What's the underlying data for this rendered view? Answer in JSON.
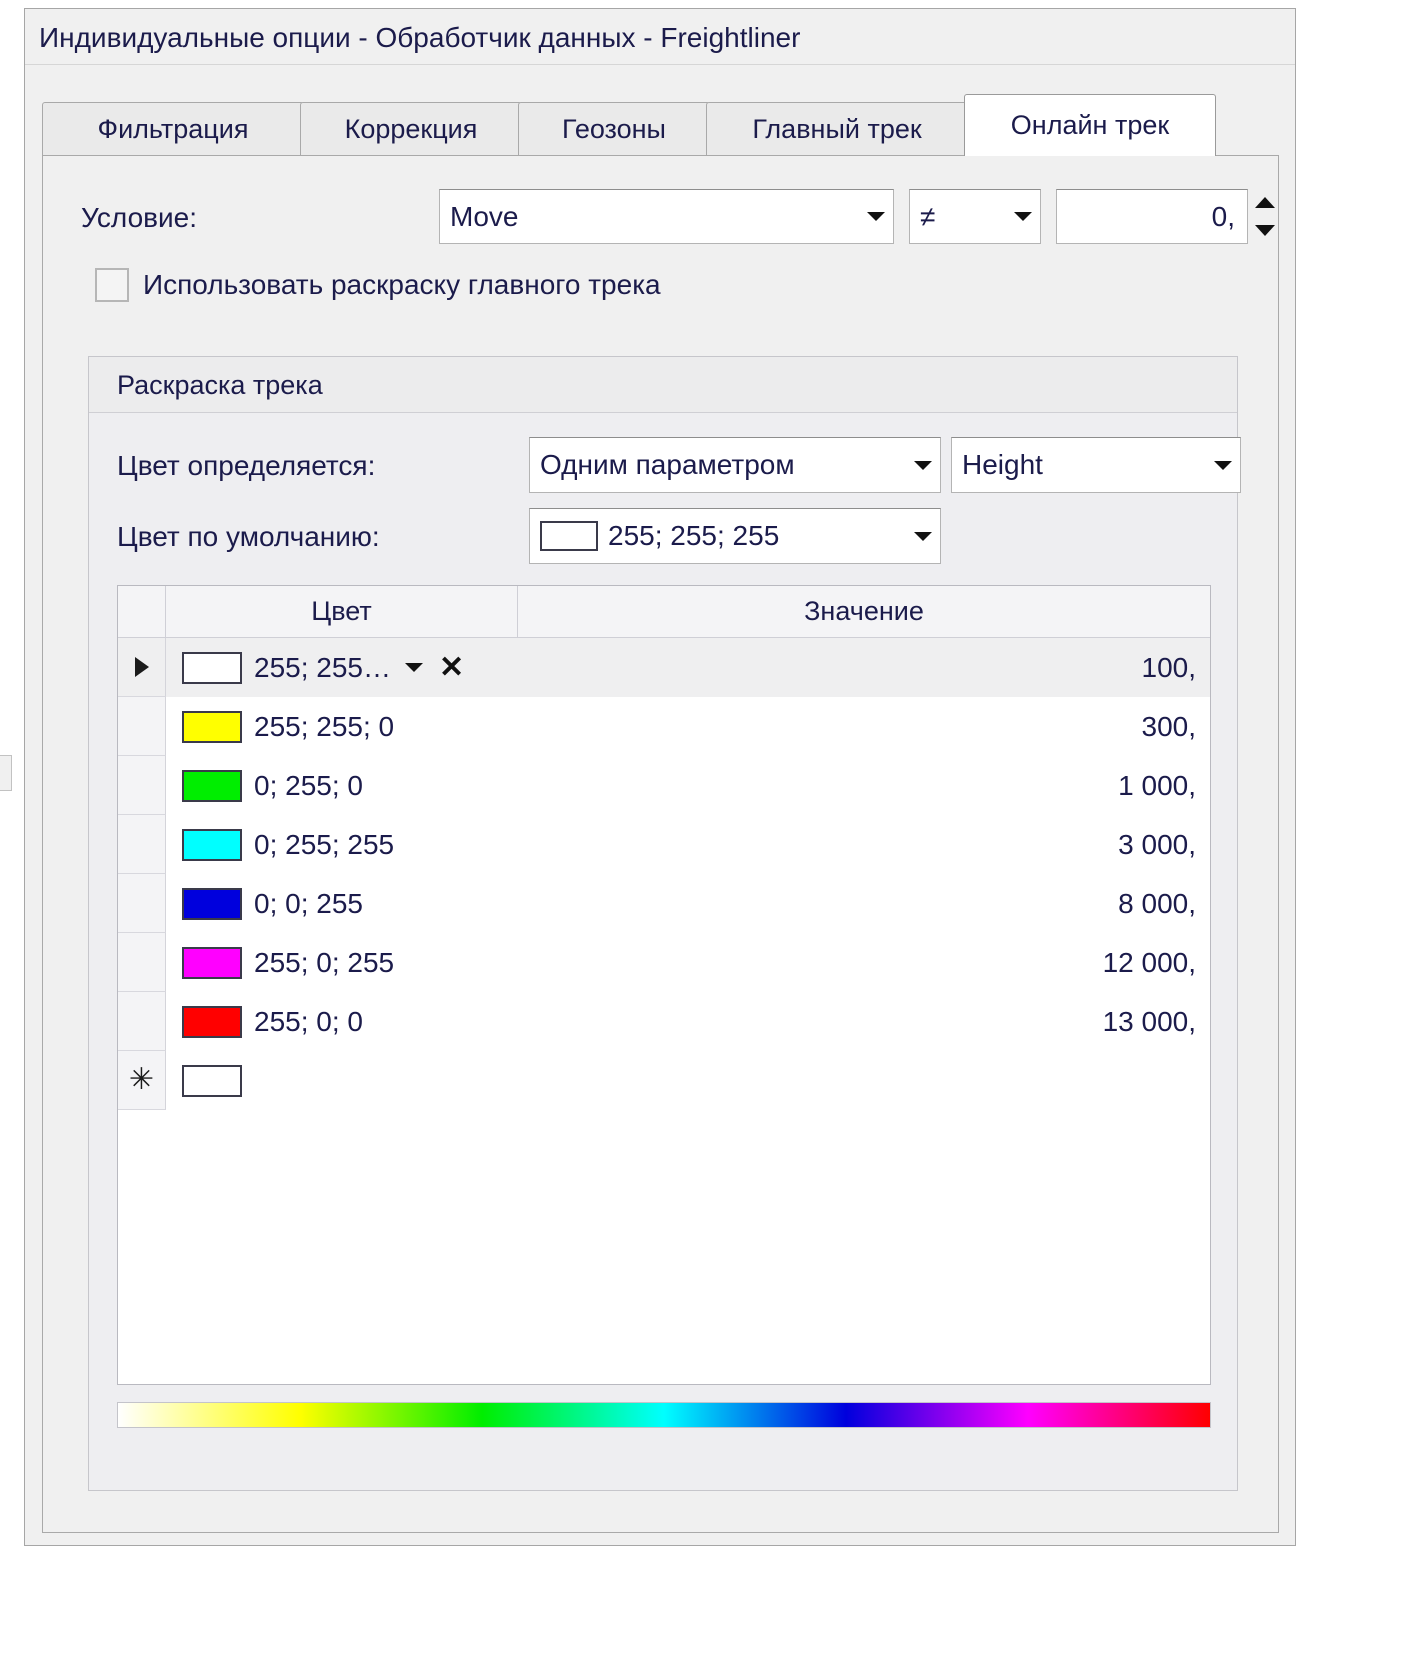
{
  "window": {
    "title": "Индивидуальные опции - Обработчик данных - Freightliner"
  },
  "tabs": [
    {
      "label": "Фильтрация",
      "active": false
    },
    {
      "label": "Коррекция",
      "active": false
    },
    {
      "label": "Геозоны",
      "active": false
    },
    {
      "label": "Главный трек",
      "active": false
    },
    {
      "label": "Онлайн трек",
      "active": true
    }
  ],
  "condition": {
    "label": "Условие:",
    "parameter": "Move",
    "operator": "≠",
    "value": "0,"
  },
  "use_main_track_colors": {
    "label": "Использовать раскраску главного трека",
    "checked": false
  },
  "track_coloring": {
    "group_title": "Раскраска трека",
    "color_by_label": "Цвет определяется:",
    "color_by_value": "Одним параметром",
    "parameter_value": "Height",
    "default_color_label": "Цвет по умолчанию:",
    "default_color_value": "255; 255; 255",
    "default_color_hex": "#ffffff"
  },
  "grid": {
    "headers": [
      "",
      "Цвет",
      "Значение"
    ],
    "rows": [
      {
        "marker": "▶",
        "color_hex": "#ffffff",
        "color_text": "255; 255…",
        "value": "100,",
        "selected": true,
        "editing": true
      },
      {
        "marker": "",
        "color_hex": "#ffff00",
        "color_text": "255; 255; 0",
        "value": "300,",
        "selected": false,
        "editing": false
      },
      {
        "marker": "",
        "color_hex": "#00ee00",
        "color_text": "0; 255; 0",
        "value": "1 000,",
        "selected": false,
        "editing": false
      },
      {
        "marker": "",
        "color_hex": "#00ffff",
        "color_text": "0; 255; 255",
        "value": "3 000,",
        "selected": false,
        "editing": false
      },
      {
        "marker": "",
        "color_hex": "#0000dd",
        "color_text": "0; 0; 255",
        "value": "8 000,",
        "selected": false,
        "editing": false
      },
      {
        "marker": "",
        "color_hex": "#ff00ff",
        "color_text": "255; 0; 255",
        "value": "12 000,",
        "selected": false,
        "editing": false
      },
      {
        "marker": "",
        "color_hex": "#ff0000",
        "color_text": "255; 0; 0",
        "value": "13 000,",
        "selected": false,
        "editing": false
      },
      {
        "marker": "✳",
        "color_hex": "#ffffff",
        "color_text": "",
        "value": "",
        "selected": false,
        "editing": false
      }
    ]
  },
  "gradient": {
    "stops": [
      "#ffffff",
      "#ffff00",
      "#00ee00",
      "#00ffff",
      "#0000dd",
      "#ff00ff",
      "#ff0000"
    ]
  },
  "icons": {
    "dropdown": "chevron-down-icon",
    "spinner_up": "spinner-up-icon",
    "spinner_down": "spinner-down-icon",
    "delete": "close-icon",
    "row_marker": "row-marker-icon",
    "new_row": "new-row-icon"
  }
}
